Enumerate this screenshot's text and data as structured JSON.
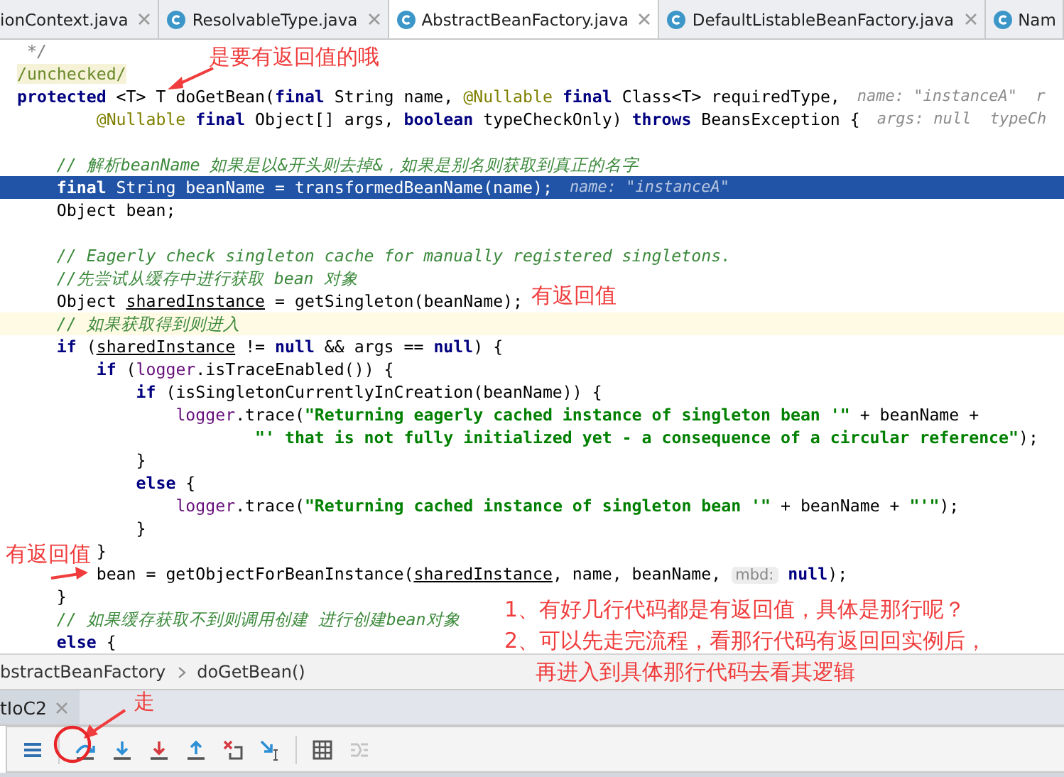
{
  "editor_tabs": [
    {
      "label": "ionContext.java",
      "selected": false
    },
    {
      "label": "ResolvableType.java",
      "selected": false
    },
    {
      "label": "AbstractBeanFactory.java",
      "selected": true
    },
    {
      "label": "DefaultListableBeanFactory.java",
      "selected": false
    },
    {
      "label": "Nam",
      "selected": false
    }
  ],
  "code": {
    "lines": [
      {
        "segments": [
          {
            "kind": "doc",
            "text": " */"
          }
        ],
        "highlighted": false,
        "caret_line": false
      },
      {
        "segments": [
          {
            "kind": "annotation_value",
            "text": "/unchecked/"
          }
        ],
        "highlighted": false,
        "caret_line": false
      },
      {
        "segments": [
          {
            "kind": "keyword",
            "text": "protected"
          },
          {
            "kind": "plain",
            "text": " <T> T doGetBean("
          },
          {
            "kind": "keyword",
            "text": "final"
          },
          {
            "kind": "plain",
            "text": " String name, "
          },
          {
            "kind": "annotation",
            "text": "@Nullable"
          },
          {
            "kind": "keyword",
            "text": " final"
          },
          {
            "kind": "plain",
            "text": " Class<T> requiredType,"
          }
        ],
        "hint": "name: \"instanceA\"  r",
        "highlighted": false,
        "caret_line": false
      },
      {
        "segments": [
          {
            "kind": "annotation",
            "text": "        @Nullable"
          },
          {
            "kind": "keyword",
            "text": " final"
          },
          {
            "kind": "plain",
            "text": " Object[] args, "
          },
          {
            "kind": "keyword",
            "text": "boolean"
          },
          {
            "kind": "plain",
            "text": " typeCheckOnly) "
          },
          {
            "kind": "keyword",
            "text": "throws"
          },
          {
            "kind": "plain",
            "text": " BeansException {"
          }
        ],
        "hint": "args: null  typeCh",
        "highlighted": false,
        "caret_line": false
      },
      {
        "highlighted": false,
        "caret_line": false
      },
      {
        "segments": [
          {
            "kind": "comment",
            "text": "    // 解析beanName 如果是以&开头则去掉&，如果是别名则获取到真正的名字"
          }
        ],
        "highlighted": false,
        "caret_line": false
      },
      {
        "segments": [
          {
            "kind": "keyword",
            "text": "    final"
          },
          {
            "kind": "plain",
            "text": " String beanName = transformedBeanName(name);"
          }
        ],
        "hint": "name: \"instanceA\"",
        "highlighted": true,
        "caret_line": false
      },
      {
        "segments": [
          {
            "kind": "plain",
            "text": "    Object bean;"
          }
        ],
        "highlighted": false,
        "caret_line": false
      },
      {
        "highlighted": false,
        "caret_line": false
      },
      {
        "segments": [
          {
            "kind": "comment",
            "text": "    // Eagerly check singleton cache for manually registered singletons."
          }
        ],
        "highlighted": false,
        "caret_line": false
      },
      {
        "segments": [
          {
            "kind": "comment",
            "text": "    //先尝试从缓存中进行获取 bean 对象"
          }
        ],
        "highlighted": false,
        "caret_line": false
      },
      {
        "segments": [
          {
            "kind": "plain",
            "text": "    Object "
          },
          {
            "kind": "underlined",
            "text": "sharedInstance"
          },
          {
            "kind": "plain",
            "text": " = getSingleton(beanName);"
          }
        ],
        "highlighted": false,
        "caret_line": false
      },
      {
        "segments": [
          {
            "kind": "comment",
            "text": "    // 如果获取得到则进入"
          }
        ],
        "highlighted": false,
        "caret_line": true
      },
      {
        "segments": [
          {
            "kind": "keyword",
            "text": "    if"
          },
          {
            "kind": "plain",
            "text": " ("
          },
          {
            "kind": "underlined",
            "text": "sharedInstance"
          },
          {
            "kind": "plain",
            "text": " != "
          },
          {
            "kind": "keyword",
            "text": "null"
          },
          {
            "kind": "plain",
            "text": " && args == "
          },
          {
            "kind": "keyword",
            "text": "null"
          },
          {
            "kind": "plain",
            "text": ") {"
          }
        ],
        "highlighted": false,
        "caret_line": false
      },
      {
        "segments": [
          {
            "kind": "keyword",
            "text": "        if"
          },
          {
            "kind": "plain",
            "text": " ("
          },
          {
            "kind": "field",
            "text": "logger"
          },
          {
            "kind": "plain",
            "text": ".isTraceEnabled()) {"
          }
        ],
        "highlighted": false,
        "caret_line": false
      },
      {
        "segments": [
          {
            "kind": "keyword",
            "text": "            if"
          },
          {
            "kind": "plain",
            "text": " (isSingletonCurrentlyInCreation(beanName)) {"
          }
        ],
        "highlighted": false,
        "caret_line": false
      },
      {
        "segments": [
          {
            "kind": "field",
            "text": "                logger"
          },
          {
            "kind": "plain",
            "text": ".trace("
          },
          {
            "kind": "string",
            "text": "\"Returning eagerly cached instance of singleton bean '\""
          },
          {
            "kind": "plain",
            "text": " + beanName +"
          }
        ],
        "highlighted": false,
        "caret_line": false
      },
      {
        "segments": [
          {
            "kind": "string",
            "text": "                        \"' that is not fully initialized yet - a consequence of a circular reference\""
          },
          {
            "kind": "plain",
            "text": ");"
          }
        ],
        "highlighted": false,
        "caret_line": false
      },
      {
        "segments": [
          {
            "kind": "plain",
            "text": "            }"
          }
        ],
        "highlighted": false,
        "caret_line": false
      },
      {
        "segments": [
          {
            "kind": "keyword",
            "text": "            else"
          },
          {
            "kind": "plain",
            "text": " {"
          }
        ],
        "highlighted": false,
        "caret_line": false
      },
      {
        "segments": [
          {
            "kind": "field",
            "text": "                logger"
          },
          {
            "kind": "plain",
            "text": ".trace("
          },
          {
            "kind": "string",
            "text": "\"Returning cached instance of singleton bean '\""
          },
          {
            "kind": "plain",
            "text": " + beanName + "
          },
          {
            "kind": "string",
            "text": "\"'\""
          },
          {
            "kind": "plain",
            "text": ");"
          }
        ],
        "highlighted": false,
        "caret_line": false
      },
      {
        "segments": [
          {
            "kind": "plain",
            "text": "            }"
          }
        ],
        "highlighted": false,
        "caret_line": false
      },
      {
        "segments": [
          {
            "kind": "plain",
            "text": "        }"
          }
        ],
        "highlighted": false,
        "caret_line": false
      },
      {
        "segments": [
          {
            "kind": "plain",
            "text": "        bean = getObjectForBeanInstance("
          },
          {
            "kind": "underlined",
            "text": "sharedInstance"
          },
          {
            "kind": "plain",
            "text": ", name, beanName, "
          },
          {
            "kind": "param_hint",
            "text": "mbd:"
          },
          {
            "kind": "keyword",
            "text": " null"
          },
          {
            "kind": "plain",
            "text": ");"
          }
        ],
        "highlighted": false,
        "caret_line": false
      },
      {
        "segments": [
          {
            "kind": "plain",
            "text": "    }"
          }
        ],
        "highlighted": false,
        "caret_line": false
      },
      {
        "segments": [
          {
            "kind": "comment",
            "text": "    // 如果缓存获取不到则调用创建 进行创建bean对象"
          }
        ],
        "highlighted": false,
        "caret_line": false
      },
      {
        "segments": [
          {
            "kind": "keyword",
            "text": "    else"
          },
          {
            "kind": "plain",
            "text": " {"
          }
        ],
        "highlighted": false,
        "caret_line": false
      }
    ]
  },
  "breadcrumb": [
    "bstractBeanFactory",
    "doGetBean()"
  ],
  "debug_tabs": [
    {
      "label": "tIoC2",
      "selected": true
    }
  ],
  "annotations": [
    {
      "text": "是要有返回值的哦"
    },
    {
      "text": "有返回值"
    },
    {
      "text": "有返回值"
    },
    {
      "text": "1、有好几行代码都是有返回值，具体是那行呢？"
    },
    {
      "text": "2、可以先走完流程，看那行代码有返回回实例后，"
    },
    {
      "text": "再进入到具体那行代码去看其逻辑"
    },
    {
      "text": "走"
    }
  ]
}
